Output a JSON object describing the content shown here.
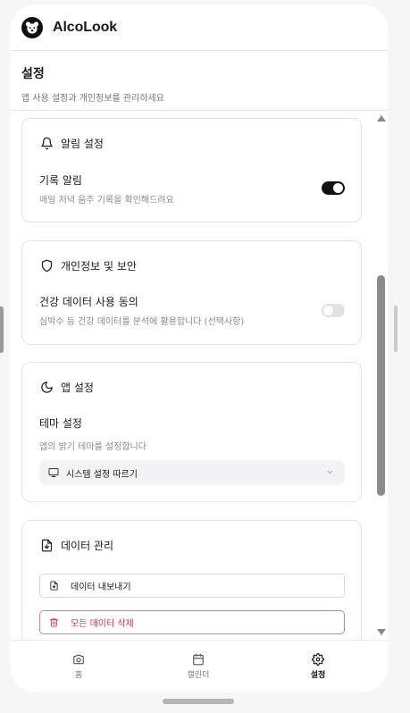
{
  "app": {
    "title": "AlcoLook"
  },
  "header": {
    "title": "설정",
    "subtitle": "앱 사용 설정과 개인정보를 관리하세요"
  },
  "sections": {
    "notifications": {
      "icon": "bell-icon",
      "title": "알림 설정",
      "item_label": "기록 알림",
      "item_desc": "매일 저녁 음주 기록을 확인해드려요",
      "enabled": true
    },
    "privacy": {
      "icon": "shield-icon",
      "title": "개인정보 및 보안",
      "item_label": "건강 데이터 사용 동의",
      "item_desc": "심박수 등 건강 데이터를 분석에 활용합니다 (선택사항)",
      "enabled": false
    },
    "app_settings": {
      "icon": "moon-icon",
      "title": "앱 설정",
      "theme_label": "테마 설정",
      "theme_desc": "앱의 밝기 테마를 설정합니다",
      "theme_value": "시스템 설정 따르기"
    },
    "data": {
      "icon": "file-download-icon",
      "title": "데이터 관리",
      "export_label": "데이터 내보내기",
      "delete_label": "모든 데이터 삭제"
    }
  },
  "nav": {
    "home": "홈",
    "calendar": "캘린더",
    "settings": "설정",
    "active": "settings"
  },
  "colors": {
    "accent": "#111111",
    "danger": "#d32f5c",
    "danger_border": "#e07a93"
  }
}
